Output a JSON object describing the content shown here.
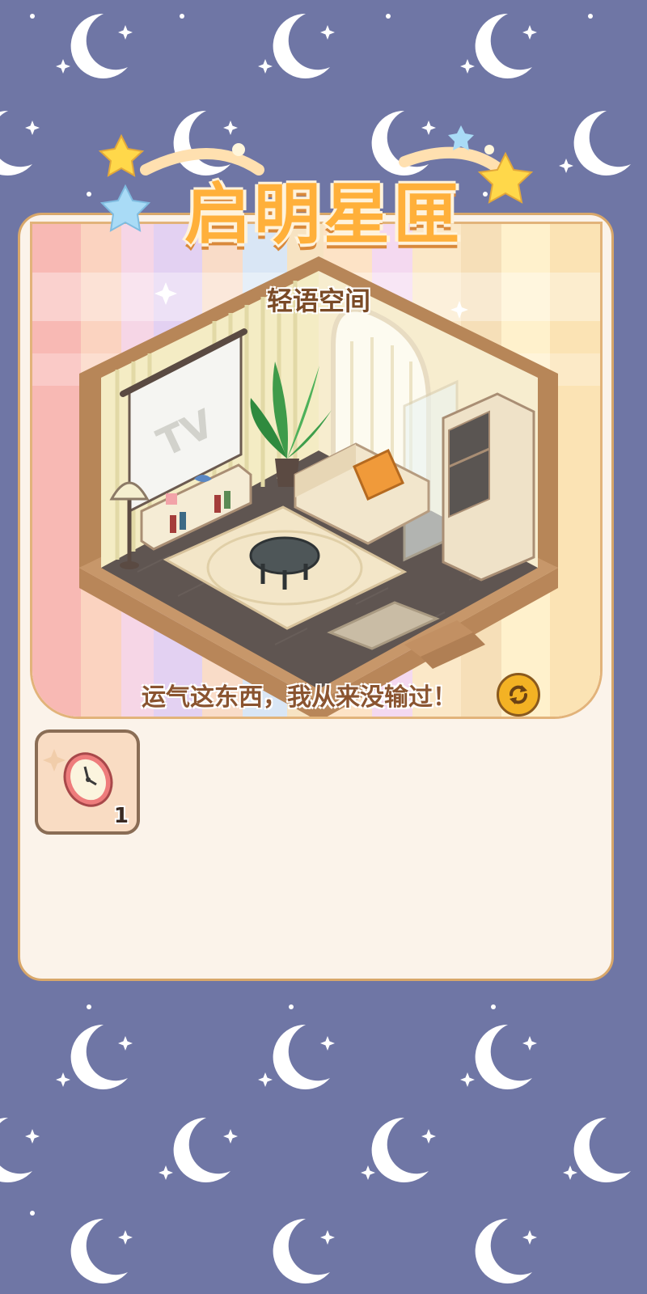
{
  "game": {
    "banner_title": "启明星匣",
    "room_name": "轻语空间",
    "quote": "运气这东西，我从来没输过！",
    "refresh_icon": "refresh-icon"
  },
  "room": {
    "tv_screen_label": "TV"
  },
  "inventory": {
    "items": [
      {
        "icon": "wall-clock-icon",
        "count": "1"
      }
    ]
  },
  "colors": {
    "background": "#6f76a5",
    "panel": "#fbf3ea",
    "panel_border": "#d8a76a",
    "title": "#ffb03a",
    "accent_button": "#f3b224"
  }
}
